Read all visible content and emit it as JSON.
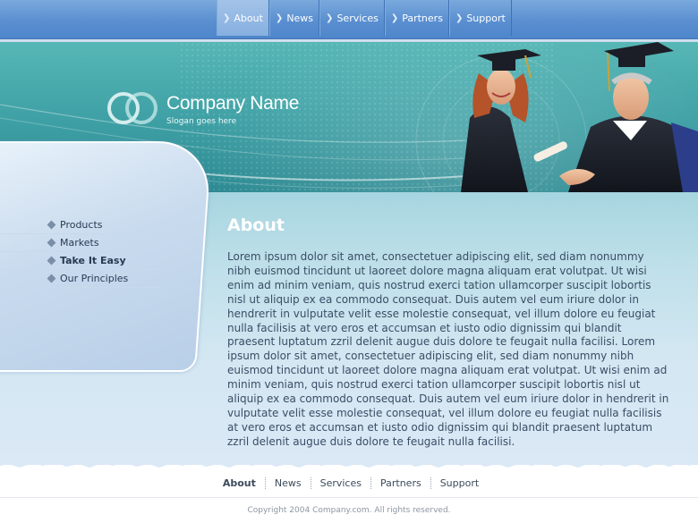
{
  "top_nav": {
    "items": [
      {
        "label": "About",
        "active": true
      },
      {
        "label": "News",
        "active": false
      },
      {
        "label": "Services",
        "active": false
      },
      {
        "label": "Partners",
        "active": false
      },
      {
        "label": "Support",
        "active": false
      }
    ]
  },
  "header": {
    "company_name": "Company Name",
    "slogan": "Slogan goes here"
  },
  "side_nav": {
    "items": [
      {
        "label": "Products",
        "bold": false
      },
      {
        "label": "Markets",
        "bold": false
      },
      {
        "label": "Take It Easy",
        "bold": true
      },
      {
        "label": "Our Principles",
        "bold": false
      }
    ]
  },
  "main": {
    "heading": "About",
    "body": "Lorem ipsum dolor sit amet, consectetuer adipiscing elit, sed diam nonummy nibh euismod tincidunt ut laoreet dolore magna aliquam erat volutpat. Ut wisi enim ad minim veniam, quis nostrud exerci tation ullamcorper suscipit lobortis nisl ut aliquip ex ea commodo consequat. Duis autem vel eum iriure dolor in hendrerit in vulputate velit esse molestie consequat, vel illum dolore eu feugiat nulla facilisis at vero eros et accumsan et iusto odio dignissim qui blandit praesent luptatum zzril delenit augue duis dolore te feugait nulla facilisi. Lorem ipsum dolor sit amet, consectetuer adipiscing elit, sed diam nonummy nibh euismod tincidunt ut laoreet dolore magna aliquam erat volutpat. Ut wisi enim ad minim veniam, quis nostrud exerci tation ullamcorper suscipit lobortis nisl ut aliquip ex ea commodo consequat. Duis autem vel eum iriure dolor in hendrerit in vulputate velit esse molestie consequat, vel illum dolore eu feugiat nulla facilisis at vero eros et accumsan et iusto odio dignissim qui blandit praesent luptatum zzril delenit augue duis dolore te feugait nulla facilisi."
  },
  "footer": {
    "nav": [
      {
        "label": "About",
        "active": true
      },
      {
        "label": "News",
        "active": false
      },
      {
        "label": "Services",
        "active": false
      },
      {
        "label": "Partners",
        "active": false
      },
      {
        "label": "Support",
        "active": false
      }
    ],
    "copyright": "Copyright 2004 Company.com. All rights reserved."
  },
  "colors": {
    "nav_blue": "#5a8fd0",
    "banner_teal": "#3d9fa4",
    "content_blue": "#bddfe9",
    "text": "#3a4d66"
  },
  "icons": {
    "top_nav_item": "chevron-right-icon",
    "side_nav_item": "diamond-bullet-icon",
    "logo": "interlocking-rings-logo"
  }
}
